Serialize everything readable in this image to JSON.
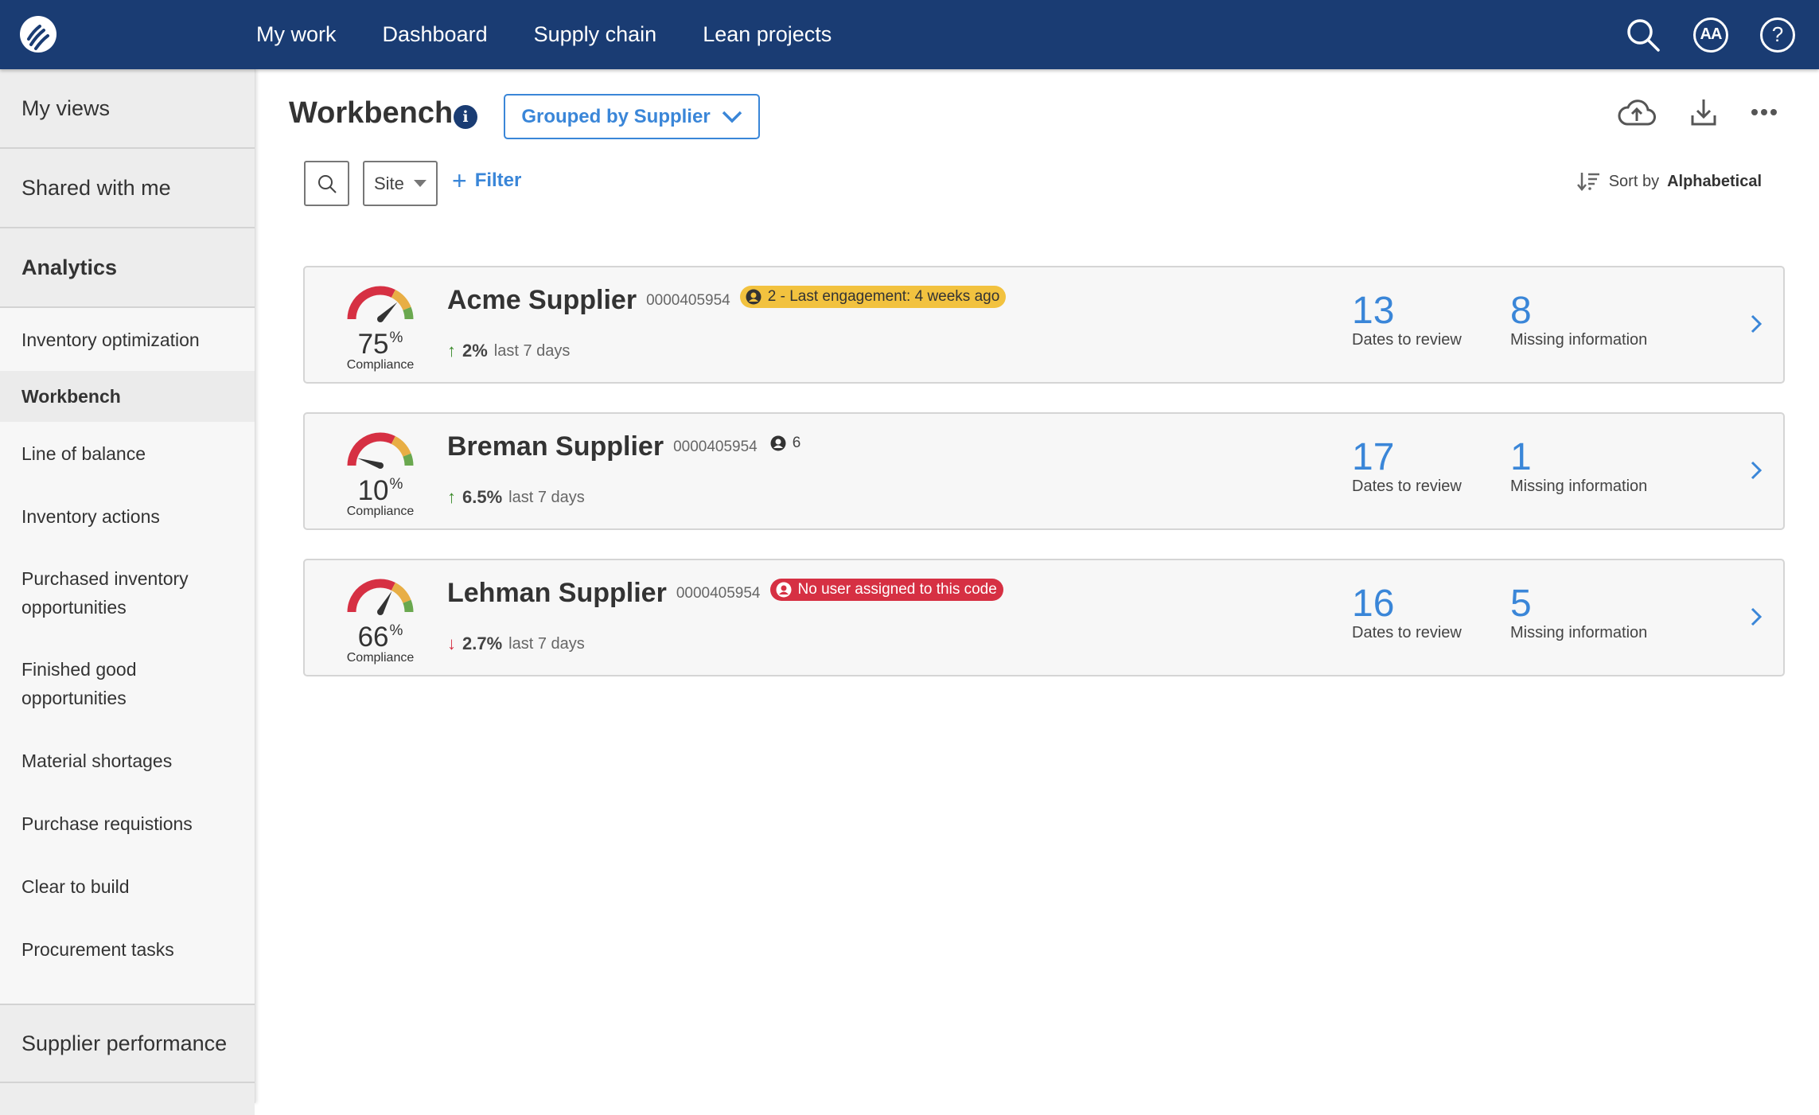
{
  "topbar": {
    "logo": "brand-logo",
    "nav": [
      "My work",
      "Dashboard",
      "Supply chain",
      "Lean projects"
    ],
    "icons": [
      "search-icon",
      "accessibility-aa-icon",
      "help-icon"
    ],
    "aa_label": "AA",
    "help_label": "?"
  },
  "sidebar": {
    "sections_top": [
      "My views",
      "Shared with me",
      "Analytics"
    ],
    "items": [
      "Inventory optimization",
      "Workbench",
      "Line of balance",
      "Inventory actions",
      "Purchased inventory opportunities",
      "Finished good opportunities",
      "Material shortages",
      "Purchase requistions",
      "Clear to build",
      "Procurement tasks"
    ],
    "active_item": "Workbench",
    "section_bottom": "Supplier performance"
  },
  "header": {
    "title": "Workbench",
    "info_glyph": "i",
    "group_by": "Grouped by Supplier",
    "actions": [
      "cloud-upload-icon",
      "download-icon",
      "more-icon"
    ]
  },
  "toolbar": {
    "site_label": "Site",
    "filter_label": "Filter",
    "filter_plus": "+",
    "sort_prefix": "Sort by",
    "sort_value": "Alphabetical"
  },
  "colors": {
    "brand": "#1a3c73",
    "accent": "#3a86d8",
    "gauge_red": "#d63043",
    "gauge_amber": "#e8ae45",
    "gauge_green": "#6aa84f",
    "warn_badge": "#f2c23f",
    "error_badge": "#d63043",
    "trend_up": "#3a8a2a",
    "trend_down": "#d63043"
  },
  "suppliers": [
    {
      "name": "Acme Supplier",
      "code": "0000405954",
      "compliance": 75,
      "compliance_unit": "%",
      "compliance_label": "Compliance",
      "badge_type": "warn",
      "badge_text": "2 - Last engagement: 4 weeks ago",
      "trend_dir": "up",
      "trend_arrow": "↑",
      "trend_pct": "2%",
      "trend_period": "last 7 days",
      "dates_to_review": "13",
      "dates_label": "Dates to review",
      "missing_info": "8",
      "missing_label": "Missing information"
    },
    {
      "name": "Breman Supplier",
      "code": "0000405954",
      "compliance": 10,
      "compliance_unit": "%",
      "compliance_label": "Compliance",
      "badge_type": "plain",
      "badge_text": "6",
      "trend_dir": "up",
      "trend_arrow": "↑",
      "trend_pct": "6.5%",
      "trend_period": "last 7 days",
      "dates_to_review": "17",
      "dates_label": "Dates to review",
      "missing_info": "1",
      "missing_label": "Missing information"
    },
    {
      "name": "Lehman Supplier",
      "code": "0000405954",
      "compliance": 66,
      "compliance_unit": "%",
      "compliance_label": "Compliance",
      "badge_type": "err",
      "badge_text": "No user assigned to this code",
      "trend_dir": "down",
      "trend_arrow": "↓",
      "trend_pct": "2.7%",
      "trend_period": "last 7 days",
      "dates_to_review": "16",
      "dates_label": "Dates to review",
      "missing_info": "5",
      "missing_label": "Missing information"
    }
  ]
}
